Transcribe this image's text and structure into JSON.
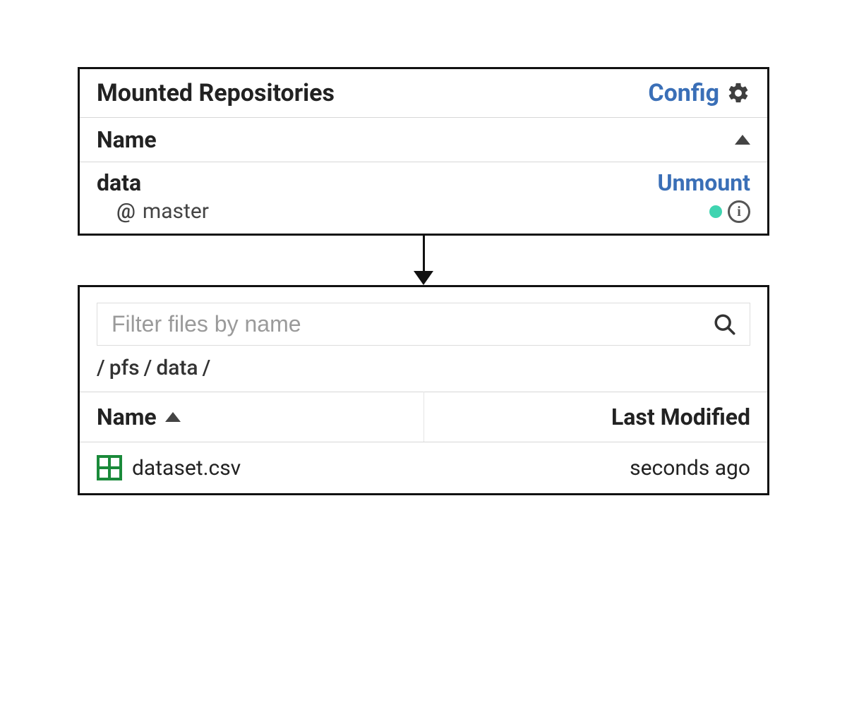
{
  "repos_panel": {
    "title": "Mounted Repositories",
    "config_label": "Config",
    "name_header": "Name",
    "rows": [
      {
        "name": "data",
        "branch": "master",
        "action": "Unmount"
      }
    ]
  },
  "file_browser": {
    "filter_placeholder": "Filter files by name",
    "breadcrumb_parts": [
      "/",
      "pfs",
      "/",
      "data",
      "/"
    ],
    "columns": {
      "name": "Name",
      "modified": "Last Modified"
    },
    "files": [
      {
        "name": "dataset.csv",
        "modified": "seconds ago",
        "type": "csv"
      }
    ]
  },
  "colors": {
    "link": "#3a6fb7",
    "status_ok": "#3fd4b0",
    "csv_green": "#1a8a3a"
  }
}
